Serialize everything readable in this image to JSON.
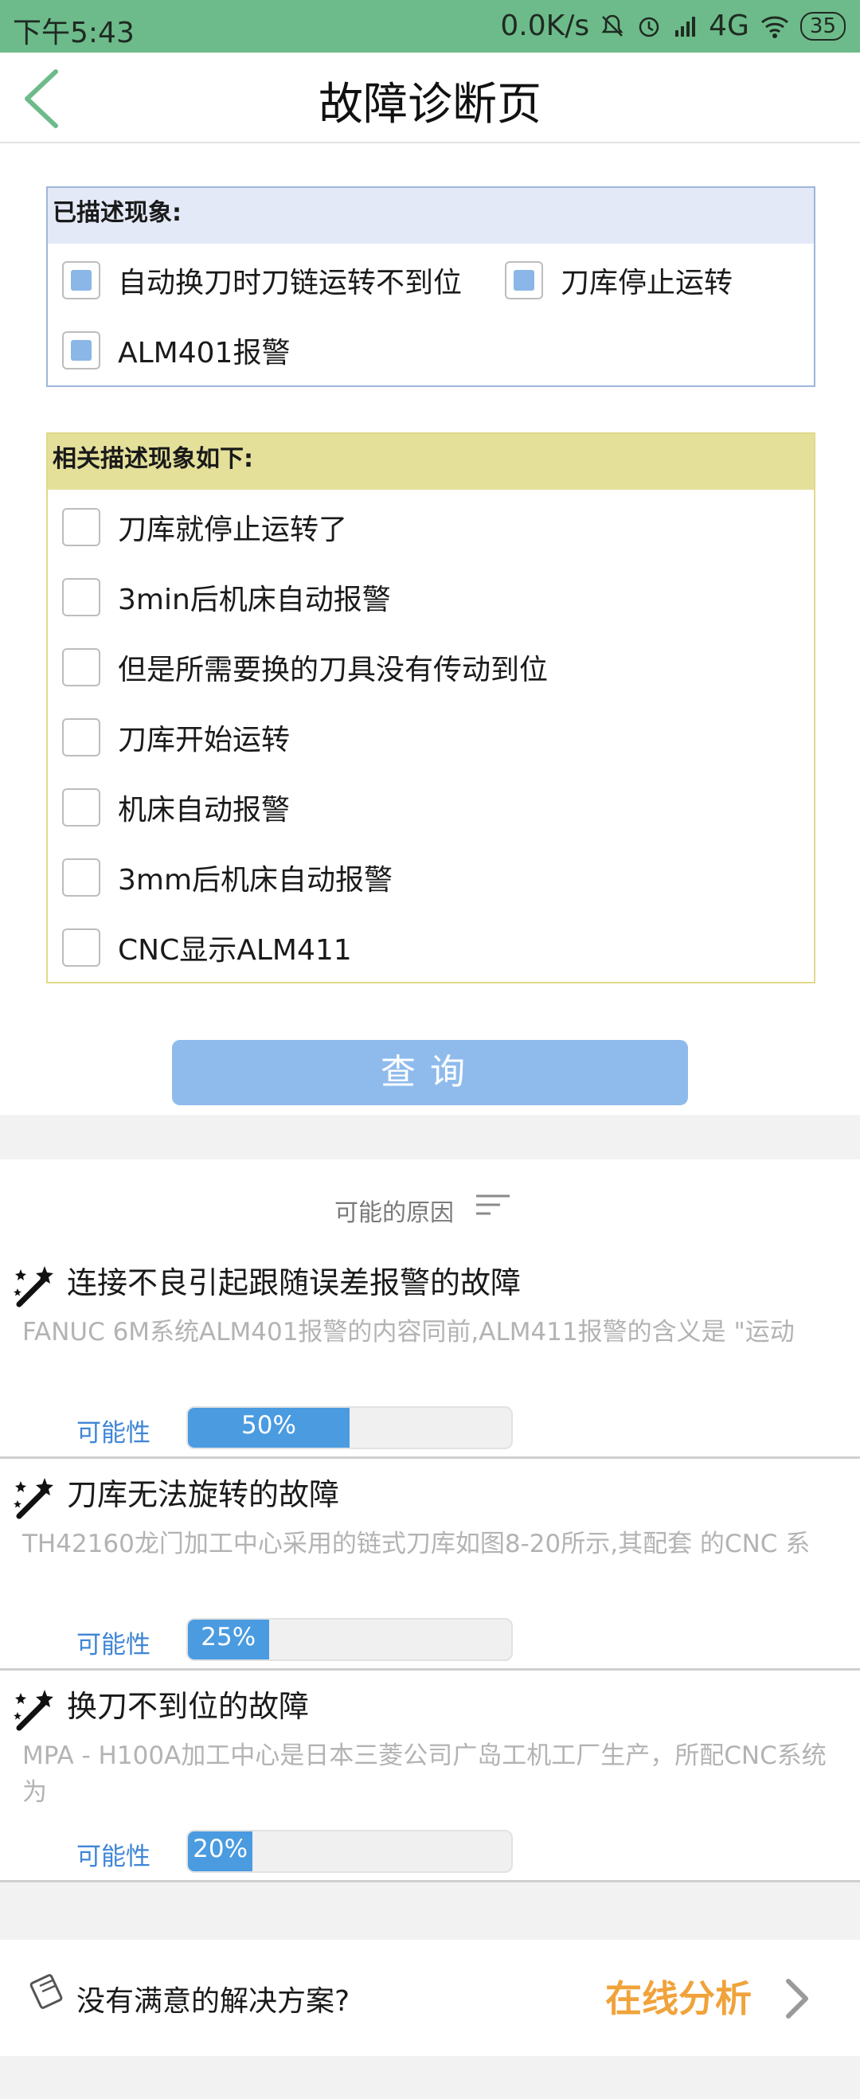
{
  "status_bar": {
    "time": "下午5:43",
    "network_speed": "0.0K/s",
    "network_type": "4G",
    "battery": "35",
    "icons": [
      "mute-bell-icon",
      "alarm-icon",
      "hd-signal-icon",
      "signal-icon",
      "wifi-icon",
      "battery-icon"
    ]
  },
  "header": {
    "title": "故障诊断页",
    "back_icon": "back-chevron-icon"
  },
  "described": {
    "heading": "已描述现象:",
    "items": [
      {
        "label": "自动换刀时刀链运转不到位",
        "checked": true
      },
      {
        "label": "刀库停止运转",
        "checked": true
      },
      {
        "label": "ALM401报警",
        "checked": true
      }
    ]
  },
  "related": {
    "heading": "相关描述现象如下:",
    "items": [
      {
        "label": "刀库就停止运转了",
        "checked": false
      },
      {
        "label": "3min后机床自动报警",
        "checked": false
      },
      {
        "label": "但是所需要换的刀具没有传动到位",
        "checked": false
      },
      {
        "label": "刀库开始运转",
        "checked": false
      },
      {
        "label": "机床自动报警",
        "checked": false
      },
      {
        "label": "3mm后机床自动报警",
        "checked": false
      },
      {
        "label": "CNC显示ALM411",
        "checked": false
      }
    ]
  },
  "query_button": "查询",
  "causes": {
    "title": "可能的原因",
    "possibility_label": "可能性",
    "items": [
      {
        "title": "连接不良引起跟随误差报警的故障",
        "desc": "FANUC 6M系统ALM401报警的内容同前,ALM411报警的含义是 \"运动",
        "percent_text": "50%",
        "percent": 50
      },
      {
        "title": "刀库无法旋转的故障",
        "desc": "TH42160龙门加工中心采用的链式刀库如图8-20所示,其配套 的CNC 系",
        "percent_text": "25%",
        "percent": 25
      },
      {
        "title": "换刀不到位的故障",
        "desc": "MPA - H100A加工中心是日本三菱公司广岛工机工厂生产，所配CNC系统为",
        "percent_text": "20%",
        "percent": 20
      }
    ]
  },
  "bottom": {
    "text": "没有满意的解决方案?",
    "action": "在线分析"
  },
  "colors": {
    "status_bar": "#6dbb8a",
    "accent_blue": "#4a9be0",
    "query_button": "#8fbbec",
    "online_orange": "#f0a33b"
  }
}
